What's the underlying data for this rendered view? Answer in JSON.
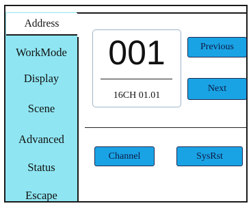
{
  "sidebar": {
    "items": [
      {
        "label": "Address"
      },
      {
        "label": "WorkMode"
      },
      {
        "label": "Display"
      },
      {
        "label": "Scene"
      },
      {
        "label": "Advanced"
      },
      {
        "label": "Status"
      },
      {
        "label": "Escape"
      }
    ],
    "selected": "Address"
  },
  "address": {
    "value": "001",
    "info": "16CH  01.01"
  },
  "buttons": {
    "previous": "Previous",
    "next": "Next",
    "channel": "Channel",
    "sysrst": "SysRst"
  },
  "colors": {
    "sidebar": "#8fe6f2",
    "button": "#1aa3e4",
    "button_border": "#1f2a52"
  }
}
